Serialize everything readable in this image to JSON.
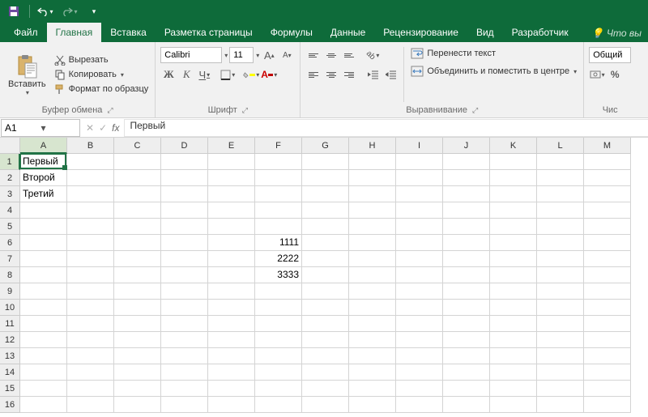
{
  "qat": {
    "save": "save-icon",
    "undo": "undo-icon",
    "redo": "redo-icon"
  },
  "tabs": {
    "file": "Файл",
    "home": "Главная",
    "insert": "Вставка",
    "layout": "Разметка страницы",
    "formulas": "Формулы",
    "data": "Данные",
    "review": "Рецензирование",
    "view": "Вид",
    "developer": "Разработчик",
    "tellme": "Что вы"
  },
  "ribbon": {
    "clipboard": {
      "paste": "Вставить",
      "cut": "Вырезать",
      "copy": "Копировать",
      "format_painter": "Формат по образцу",
      "label": "Буфер обмена"
    },
    "font": {
      "name": "Calibri",
      "size": "11",
      "bold": "Ж",
      "italic": "К",
      "underline": "Ч",
      "increase": "A",
      "decrease": "A",
      "label": "Шрифт"
    },
    "alignment": {
      "wrap": "Перенести текст",
      "merge": "Объединить и поместить в центре",
      "label": "Выравнивание"
    },
    "number": {
      "format": "Общий",
      "label": "Чис"
    }
  },
  "formula_bar": {
    "cell_ref": "A1",
    "value": "Первый"
  },
  "columns": [
    "A",
    "B",
    "C",
    "D",
    "E",
    "F",
    "G",
    "H",
    "I",
    "J",
    "K",
    "L",
    "M"
  ],
  "rows": [
    "1",
    "2",
    "3",
    "4",
    "5",
    "6",
    "7",
    "8",
    "9",
    "10",
    "11",
    "12",
    "13",
    "14",
    "15",
    "16"
  ],
  "cells": {
    "A1": "Первый",
    "A2": "Второй",
    "A3": "Третий",
    "F6": "1111",
    "F7": "2222",
    "F8": "3333"
  },
  "selection": {
    "col": 0,
    "row": 0
  }
}
